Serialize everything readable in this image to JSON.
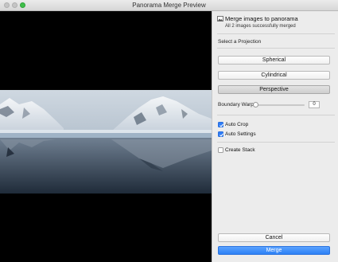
{
  "window": {
    "title": "Panorama Merge Preview"
  },
  "header": {
    "title": "Merge images to panorama",
    "subtitle": "All 2 images successfully merged"
  },
  "projection": {
    "section_label": "Select a Projection",
    "options": [
      {
        "label": "Spherical",
        "selected": false
      },
      {
        "label": "Cylindrical",
        "selected": false
      },
      {
        "label": "Perspective",
        "selected": true
      }
    ]
  },
  "boundary_warp": {
    "label": "Boundary Warp:",
    "value": "0",
    "level": 0
  },
  "checkboxes": [
    {
      "label": "Auto Crop",
      "checked": true
    },
    {
      "label": "Auto Settings",
      "checked": true
    },
    {
      "label": "Create Stack",
      "checked": false
    }
  ],
  "buttons": {
    "cancel": "Cancel",
    "merge": "Merge"
  },
  "colors": {
    "accent": "#2e7cf6",
    "preview_bg": "#000000",
    "panel_bg": "#ececec"
  },
  "icons": {
    "header": "panorama-image-icon",
    "checkbox": "checkmark-icon"
  }
}
